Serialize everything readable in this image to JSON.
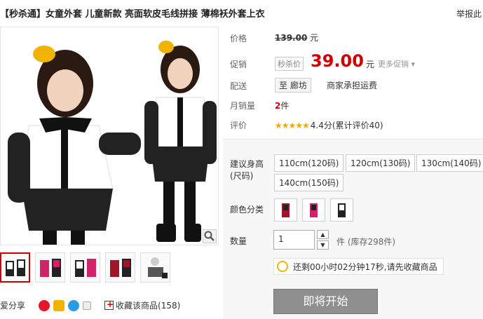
{
  "product": {
    "title": "【秒杀通】女童外套 儿童新款 亮面软皮毛线拼接 薄棉袄外套上衣",
    "report_label": "举报此"
  },
  "price": {
    "label": "价格",
    "original": "139.00",
    "currency_unit": "元"
  },
  "promo": {
    "label": "促销",
    "tag": "秒杀价",
    "price": "39.00",
    "unit": "元",
    "more_label": "更多促销"
  },
  "delivery": {
    "label": "配送",
    "destination": "至 廊坊",
    "note": "商家承担运费"
  },
  "monthly_sales": {
    "label": "月销量",
    "count": "2",
    "unit": "件"
  },
  "review": {
    "label": "评价",
    "stars": "★★★★★",
    "text": "4.4分(累计评价40)"
  },
  "sku": {
    "size_label": "建议身高(尺码)",
    "sizes": [
      "110cm(120码)",
      "120cm(130码)",
      "130cm(140码)",
      "140cm(150码)"
    ],
    "color_label": "颜色分类",
    "quantity_label": "数量",
    "quantity_value": "1",
    "stock_text": "件 (库存298件)"
  },
  "tip": {
    "text": "还剩00小时02分钟17秒,请先收藏商品"
  },
  "start_button": "即将开始",
  "share": {
    "label": "爱分享",
    "favorite": "收藏该商品(158)"
  },
  "colors": {
    "accent": "#cc0000",
    "star": "#f6a800"
  }
}
